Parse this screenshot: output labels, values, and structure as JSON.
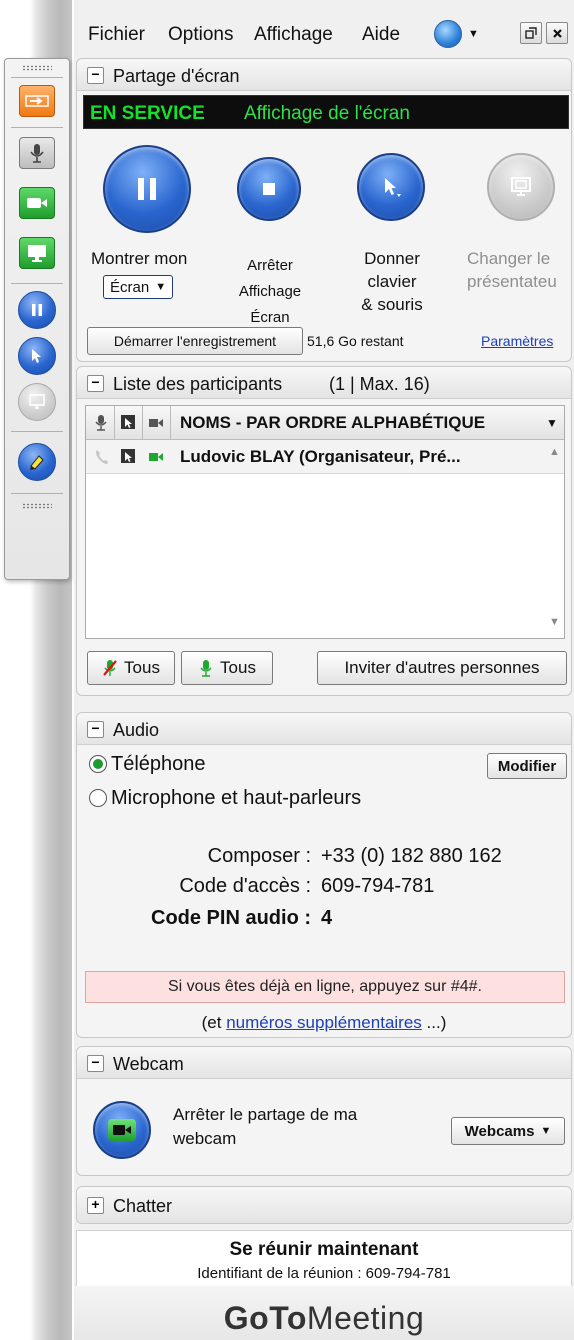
{
  "menu": {
    "file": "Fichier",
    "options": "Options",
    "view": "Affichage",
    "help": "Aide"
  },
  "screen_share": {
    "title": "Partage d'écran",
    "status_on": "EN SERVICE",
    "status_text": "Affichage de l'écran",
    "show_label": "Montrer mon",
    "screen_select": "Écran",
    "stop_label": [
      "Arrêter",
      "Affichage",
      "Écran"
    ],
    "give_label": [
      "Donner",
      "clavier",
      "& souris"
    ],
    "change_label": [
      "Changer le",
      "présentateu"
    ],
    "record_button": "Démarrer l'enregistrement",
    "remaining": "51,6 Go restant",
    "settings_link": "Paramètres"
  },
  "participants": {
    "title": "Liste des participants",
    "count": "(1 | Max. 16)",
    "column_names": "NOMS - PAR ORDRE ALPHABÉTIQUE",
    "rows": [
      {
        "name": "Ludovic BLAY (Organisateur, Pré..."
      }
    ],
    "mute_all": "Tous",
    "unmute_all": "Tous",
    "invite": "Inviter d'autres personnes"
  },
  "audio": {
    "title": "Audio",
    "option_phone": "Téléphone",
    "option_mic": "Microphone et haut-parleurs",
    "modify": "Modifier",
    "dial_label": "Composer :",
    "dial_value": "+33 (0) 182 880 162",
    "access_label": "Code d'accès :",
    "access_value": "609-794-781",
    "pin_label": "Code PIN audio :",
    "pin_value": "4",
    "notice": "Si vous êtes déjà en ligne, appuyez sur #4#.",
    "more_prefix": "(et",
    "more_link": "numéros supplémentaires",
    "more_suffix": "...)"
  },
  "webcam": {
    "title": "Webcam",
    "stop_text": [
      "Arrêter le partage de ma",
      "webcam"
    ],
    "select": "Webcams"
  },
  "chat": {
    "title": "Chatter"
  },
  "footer": {
    "meet_now": "Se réunir maintenant",
    "meeting_id": "Identifiant de la réunion : 609-794-781",
    "logo_bold": "GoTo",
    "logo_light": "Meeting"
  },
  "colors": {
    "status_green": "#17e02b",
    "accent_blue": "#2a66cf",
    "notice_bg": "#fde1e1"
  }
}
